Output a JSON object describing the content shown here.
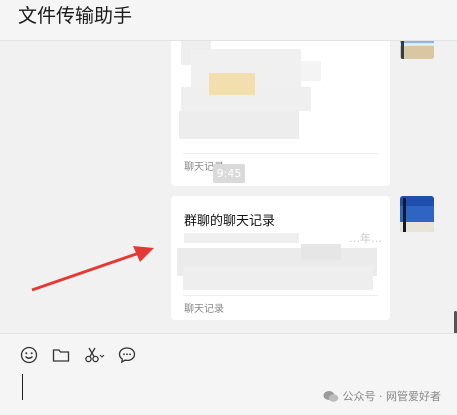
{
  "window": {
    "title": "文件传输助手"
  },
  "messages": [
    {
      "type": "chat-record",
      "title": "",
      "footer": "聊天记录"
    },
    {
      "type": "time",
      "text": "9:45"
    },
    {
      "type": "chat-record",
      "title": "群聊的聊天记录",
      "preview_fragment": "…年…",
      "footer": "聊天记录"
    }
  ],
  "toolbar": {
    "icons": [
      "emoji-icon",
      "folder-icon",
      "scissors-icon",
      "chat-bubble-icon"
    ]
  },
  "watermark": {
    "text": "公众号 · 网管爱好者"
  }
}
